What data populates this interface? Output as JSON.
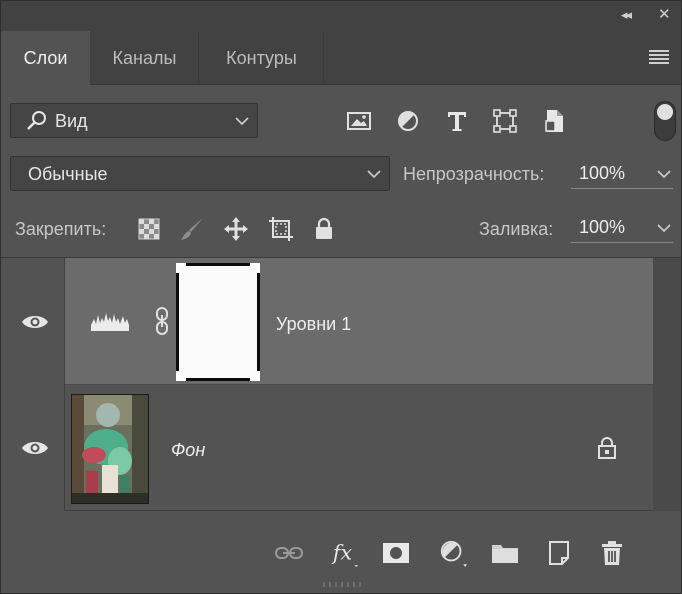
{
  "tabs": [
    {
      "label": "Слои"
    },
    {
      "label": "Каналы"
    },
    {
      "label": "Контуры"
    }
  ],
  "window": {
    "collapse_glyph": "◂◂",
    "close_glyph": "✕"
  },
  "filter": {
    "kind_label": "Вид",
    "icons": [
      "image-filter-icon",
      "adjustment-filter-icon",
      "type-filter-icon",
      "shape-filter-icon",
      "smart-object-filter-icon"
    ]
  },
  "blend": {
    "mode": "Обычные",
    "opacity_label": "Непрозрачность:",
    "opacity_value": "100%"
  },
  "lock": {
    "label": "Закрепить:",
    "fill_label": "Заливка:",
    "fill_value": "100%"
  },
  "layers": [
    {
      "name": "Уровни 1",
      "type": "adjustment-levels",
      "visible": true,
      "selected": true
    },
    {
      "name": "Фон",
      "type": "background",
      "visible": true,
      "locked": true
    }
  ],
  "colors": {
    "panel": "#535353",
    "header": "#424242",
    "selected_row": "#6b6b6b"
  }
}
